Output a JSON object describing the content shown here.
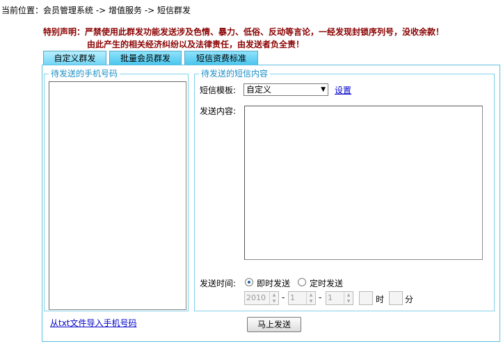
{
  "breadcrumb": {
    "text": "当前位置：会员管理系统 -> 增值服务 -> 短信群发"
  },
  "notice": {
    "line1": "特别声明：严禁使用此群发功能发送涉及色情、暴力、低俗、反动等言论，一经发现封锁序列号，没收余款！",
    "line2": "由此产生的相关经济纠纷以及法律责任，由发送者负全责！"
  },
  "tabs": [
    {
      "label": "自定义群发",
      "active": true
    },
    {
      "label": "批量会员群发",
      "active": false
    },
    {
      "label": "短信资费标准",
      "active": false
    }
  ],
  "phone_section": {
    "legend": "待发送的手机号码",
    "import_link": "从txt文件导入手机号码"
  },
  "sms_section": {
    "legend": "待发送的短信内容",
    "template_label": "短信模板:",
    "template_value": "自定义",
    "settings_link": "设置",
    "content_label": "发送内容:",
    "time_label": "发送时间:",
    "option_now": "即时发送",
    "option_scheduled": "定时发送",
    "year": "2010",
    "month": "1",
    "day": "1",
    "dash": "-",
    "hour_unit": "时",
    "minute_unit": "分"
  },
  "send_button": "马上发送",
  "colors": {
    "notice": "#8b0000",
    "tab_bg": "#48c4ec",
    "border": "#5bc0de",
    "legend": "#1a8fc8",
    "link": "#0000cc"
  },
  "icons": {
    "dropdown": "chevron-down-icon",
    "spin_up": "spin-up-icon",
    "spin_down": "spin-down-icon"
  }
}
